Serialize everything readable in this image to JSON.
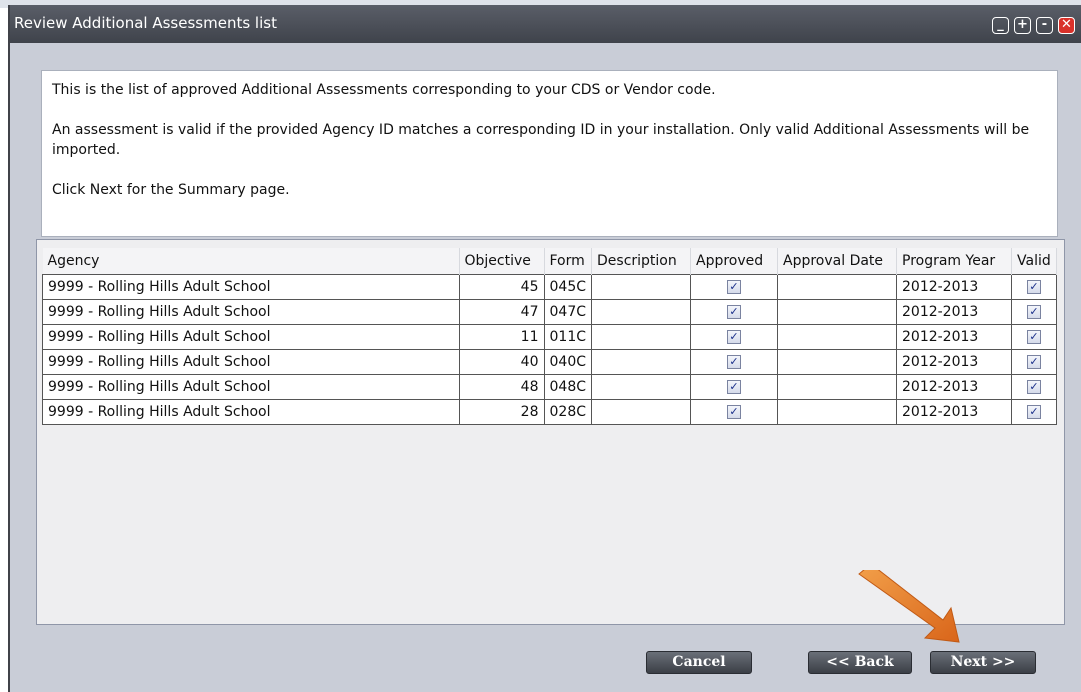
{
  "window": {
    "title": "Review Additional Assessments list"
  },
  "controls": {
    "minimize": "_",
    "add": "+",
    "remove": "-",
    "close": "✕"
  },
  "info": {
    "line1": "This is the list of approved Additional Assessments corresponding to your CDS or Vendor code.",
    "line2": "An assessment is valid if the provided Agency ID matches a corresponding ID in your installation. Only valid Additional Assessments will be imported.",
    "line3": "Click Next for the Summary page."
  },
  "table": {
    "headers": [
      "Agency",
      "Objective",
      "Form",
      "Description",
      "Approved",
      "Approval Date",
      "Program Year",
      "Valid"
    ],
    "rows": [
      {
        "agency": "9999 - Rolling Hills Adult School",
        "objective": "45",
        "form": "045C",
        "description": "",
        "approved": true,
        "approval_date": "",
        "program_year": "2012-2013",
        "valid": true
      },
      {
        "agency": "9999 - Rolling Hills Adult School",
        "objective": "47",
        "form": "047C",
        "description": "",
        "approved": true,
        "approval_date": "",
        "program_year": "2012-2013",
        "valid": true
      },
      {
        "agency": "9999 - Rolling Hills Adult School",
        "objective": "11",
        "form": "011C",
        "description": "",
        "approved": true,
        "approval_date": "",
        "program_year": "2012-2013",
        "valid": true
      },
      {
        "agency": "9999 - Rolling Hills Adult School",
        "objective": "40",
        "form": "040C",
        "description": "",
        "approved": true,
        "approval_date": "",
        "program_year": "2012-2013",
        "valid": true
      },
      {
        "agency": "9999 - Rolling Hills Adult School",
        "objective": "48",
        "form": "048C",
        "description": "",
        "approved": true,
        "approval_date": "",
        "program_year": "2012-2013",
        "valid": true
      },
      {
        "agency": "9999 - Rolling Hills Adult School",
        "objective": "28",
        "form": "028C",
        "description": "",
        "approved": true,
        "approval_date": "",
        "program_year": "2012-2013",
        "valid": true
      }
    ]
  },
  "buttons": {
    "cancel": "Cancel",
    "back": "<< Back",
    "next": "Next >>"
  },
  "check_glyph": "✓",
  "colors": {
    "titlebar": "#4b4f57",
    "window_bg": "#c9cdd7",
    "button": "#4d5159",
    "arrow": "#e07a1f",
    "close": "#d9312a"
  }
}
